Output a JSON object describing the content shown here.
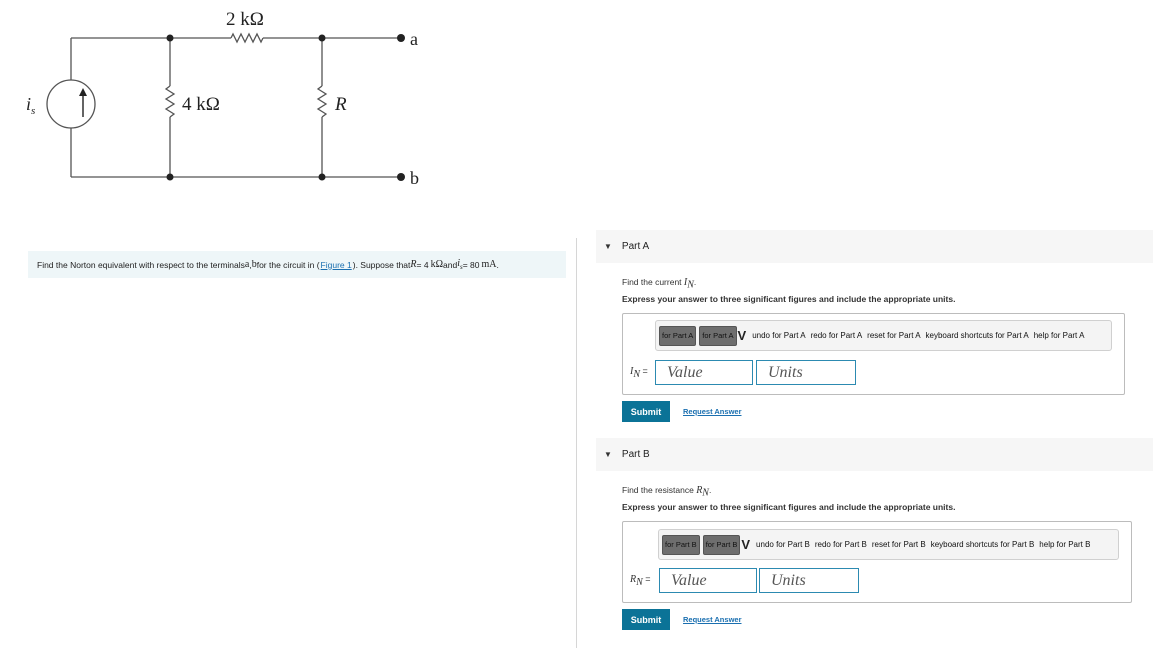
{
  "circuit": {
    "resistor_top": "2 kΩ",
    "resistor_left": "4 kΩ",
    "resistor_r": "R",
    "source_label": "i",
    "source_sub": "s",
    "terminal_a": "a",
    "terminal_b": "b"
  },
  "problem": {
    "text1": "Find the Norton equivalent with respect to the terminals ",
    "a": "a",
    "comma": ", ",
    "b": "b",
    "text2": " for the circuit in (",
    "figure_link": "Figure 1",
    "text3": "). Suppose that ",
    "R": "R",
    "eq1": " = 4 ",
    "kohm": "kΩ",
    "and": " and ",
    "is": "i",
    "is_sub": "s",
    "eq2": " = 80 ",
    "ma": "mA",
    "end": " ."
  },
  "partA": {
    "title": "Part A",
    "question": "Find the current ",
    "var": "I",
    "var_sub": "N",
    "instruction": "Express your answer to three significant figures and include the appropriate units.",
    "toolbar": {
      "btn1": "for Part A",
      "btn2": "for Part A",
      "undo": "undo for Part A",
      "redo": "redo for Part A",
      "reset": "reset for Part A",
      "keyboard": "keyboard shortcuts for Part A",
      "help": "help for Part A"
    },
    "input_label_var": "I",
    "input_label_sub": "N",
    "input_label_eq": " =",
    "value_placeholder": "Value",
    "units_placeholder": "Units",
    "submit": "Submit",
    "request": "Request Answer"
  },
  "partB": {
    "title": "Part B",
    "question": "Find the resistance ",
    "var": "R",
    "var_sub": "N",
    "instruction": "Express your answer to three significant figures and include the appropriate units.",
    "toolbar": {
      "btn1": "for Part B",
      "btn2": "for Part B",
      "undo": "undo for Part B",
      "redo": "redo for Part B",
      "reset": "reset for Part B",
      "keyboard": "keyboard shortcuts for Part B",
      "help": "help for Part B"
    },
    "input_label_var": "R",
    "input_label_sub": "N",
    "input_label_eq": " =",
    "value_placeholder": "Value",
    "units_placeholder": "Units",
    "submit": "Submit",
    "request": "Request Answer"
  },
  "colors": {
    "submit_bg": "#0b7397",
    "field_border": "#2c8ab1",
    "link": "#1a6fb0",
    "problem_bg": "#eef6f8"
  }
}
